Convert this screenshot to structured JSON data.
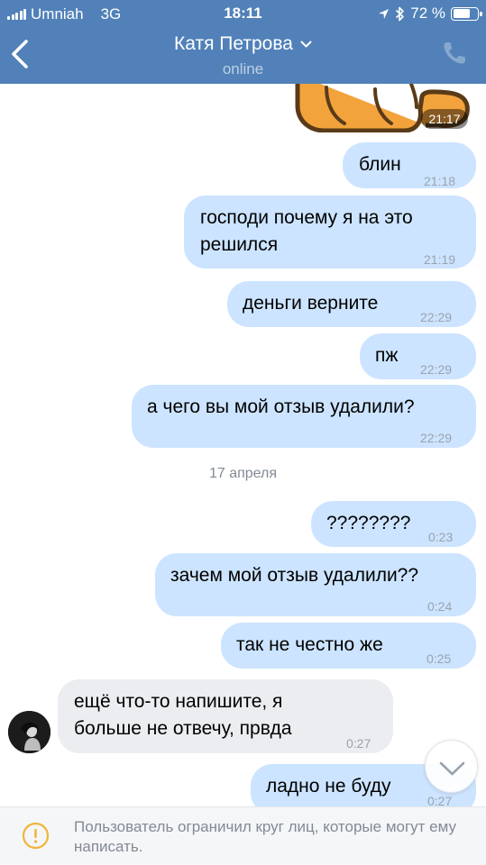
{
  "status_bar": {
    "carrier": "Umniah",
    "network": "3G",
    "time": "18:11",
    "battery_level": "72 %"
  },
  "header": {
    "title": "Катя Петрова",
    "subtitle": "online"
  },
  "messages": [
    {
      "time": "21:17",
      "type": "sticker"
    },
    {
      "text": "блин",
      "time": "21:18"
    },
    {
      "text": "господи почему я на это решился",
      "line1": "господи почему я на это",
      "line2": "решился",
      "time": "21:19"
    },
    {
      "text": "деньги верните",
      "time": "22:29"
    },
    {
      "text": "пж",
      "time": "22:29"
    },
    {
      "text": "а чего вы мой отзыв удалили?",
      "time": "22:29"
    },
    {
      "text": "????????",
      "time": "0:23"
    },
    {
      "text": "зачем мой отзыв удалили??",
      "time": "0:24"
    },
    {
      "text": "так не честно же",
      "time": "0:25"
    },
    {
      "text": "ещё что-то напишите, я больше не отвечу, првда",
      "line1": "ещё что-то напишите, я",
      "line2": "больше не отвечу, првда",
      "time": "0:27"
    },
    {
      "text": "ладно не буду",
      "time": "0:27"
    }
  ],
  "date_divider": "17 апреля",
  "footer": {
    "restriction_text": "Пользователь ограничил круг лиц, которые могут ему написать."
  },
  "colors": {
    "header": "#5181b8",
    "outgoing_bubble": "#cce4ff",
    "incoming_bubble": "#ebedf0",
    "sticker": "#f2a33c"
  },
  "icons": [
    "signal-icon",
    "back-arrow-icon",
    "chevron-down-icon",
    "phone-icon",
    "location-arrow-icon",
    "bluetooth-icon",
    "battery-icon",
    "warning-icon",
    "chevron-down-icon"
  ]
}
